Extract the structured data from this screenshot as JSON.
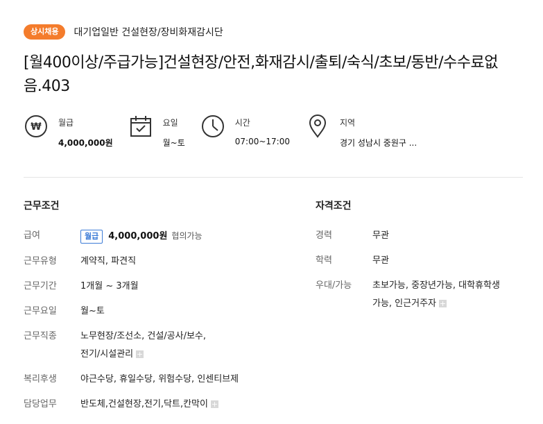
{
  "header": {
    "badge": "상시채용",
    "company": "대기업일반 건설현장/장비화재감시단"
  },
  "title": "[월400이상/주급가능]건설현장/안전,화재감시/출퇴/숙식/초보/동반/수수료없음.403",
  "summary": {
    "pay": {
      "icon": "won-icon",
      "label": "월급",
      "value": "4,000,000원"
    },
    "days": {
      "icon": "calendar-icon",
      "label": "요일",
      "value": "월~토"
    },
    "time": {
      "icon": "clock-icon",
      "label": "시간",
      "value": "07:00~17:00"
    },
    "region": {
      "icon": "location-pin-icon",
      "label": "지역",
      "value": "경기 성남시 중원구 ..."
    }
  },
  "work_conditions": {
    "heading": "근무조건",
    "salary": {
      "key": "급여",
      "type": "월급",
      "amount": "4,000,000원",
      "note": "협의가능"
    },
    "employment_type": {
      "key": "근무유형",
      "value": "계약직, 파견직"
    },
    "period": {
      "key": "근무기간",
      "value": "1개월 ~ 3개월"
    },
    "days": {
      "key": "근무요일",
      "value": "월~토"
    },
    "job": {
      "key": "근무직종",
      "line1": "노무현장/조선소, 건설/공사/보수,",
      "line2": "전기/시설관리"
    },
    "benefits": {
      "key": "복리후생",
      "value": "야근수당, 휴일수당, 위험수당, 인센티브제"
    },
    "duties": {
      "key": "담당업무",
      "value": "반도체,건설현장,전기,닥트,칸막이"
    }
  },
  "qualifications": {
    "heading": "자격조건",
    "career": {
      "key": "경력",
      "value": "무관"
    },
    "education": {
      "key": "학력",
      "value": "무관"
    },
    "preferred": {
      "key": "우대/가능",
      "line1": "초보가능, 중장년가능, 대학휴학생",
      "line2": "가능, 인근거주자"
    }
  },
  "colors": {
    "badge": "#f47c2c",
    "salary_type": "#3b7bd6"
  }
}
